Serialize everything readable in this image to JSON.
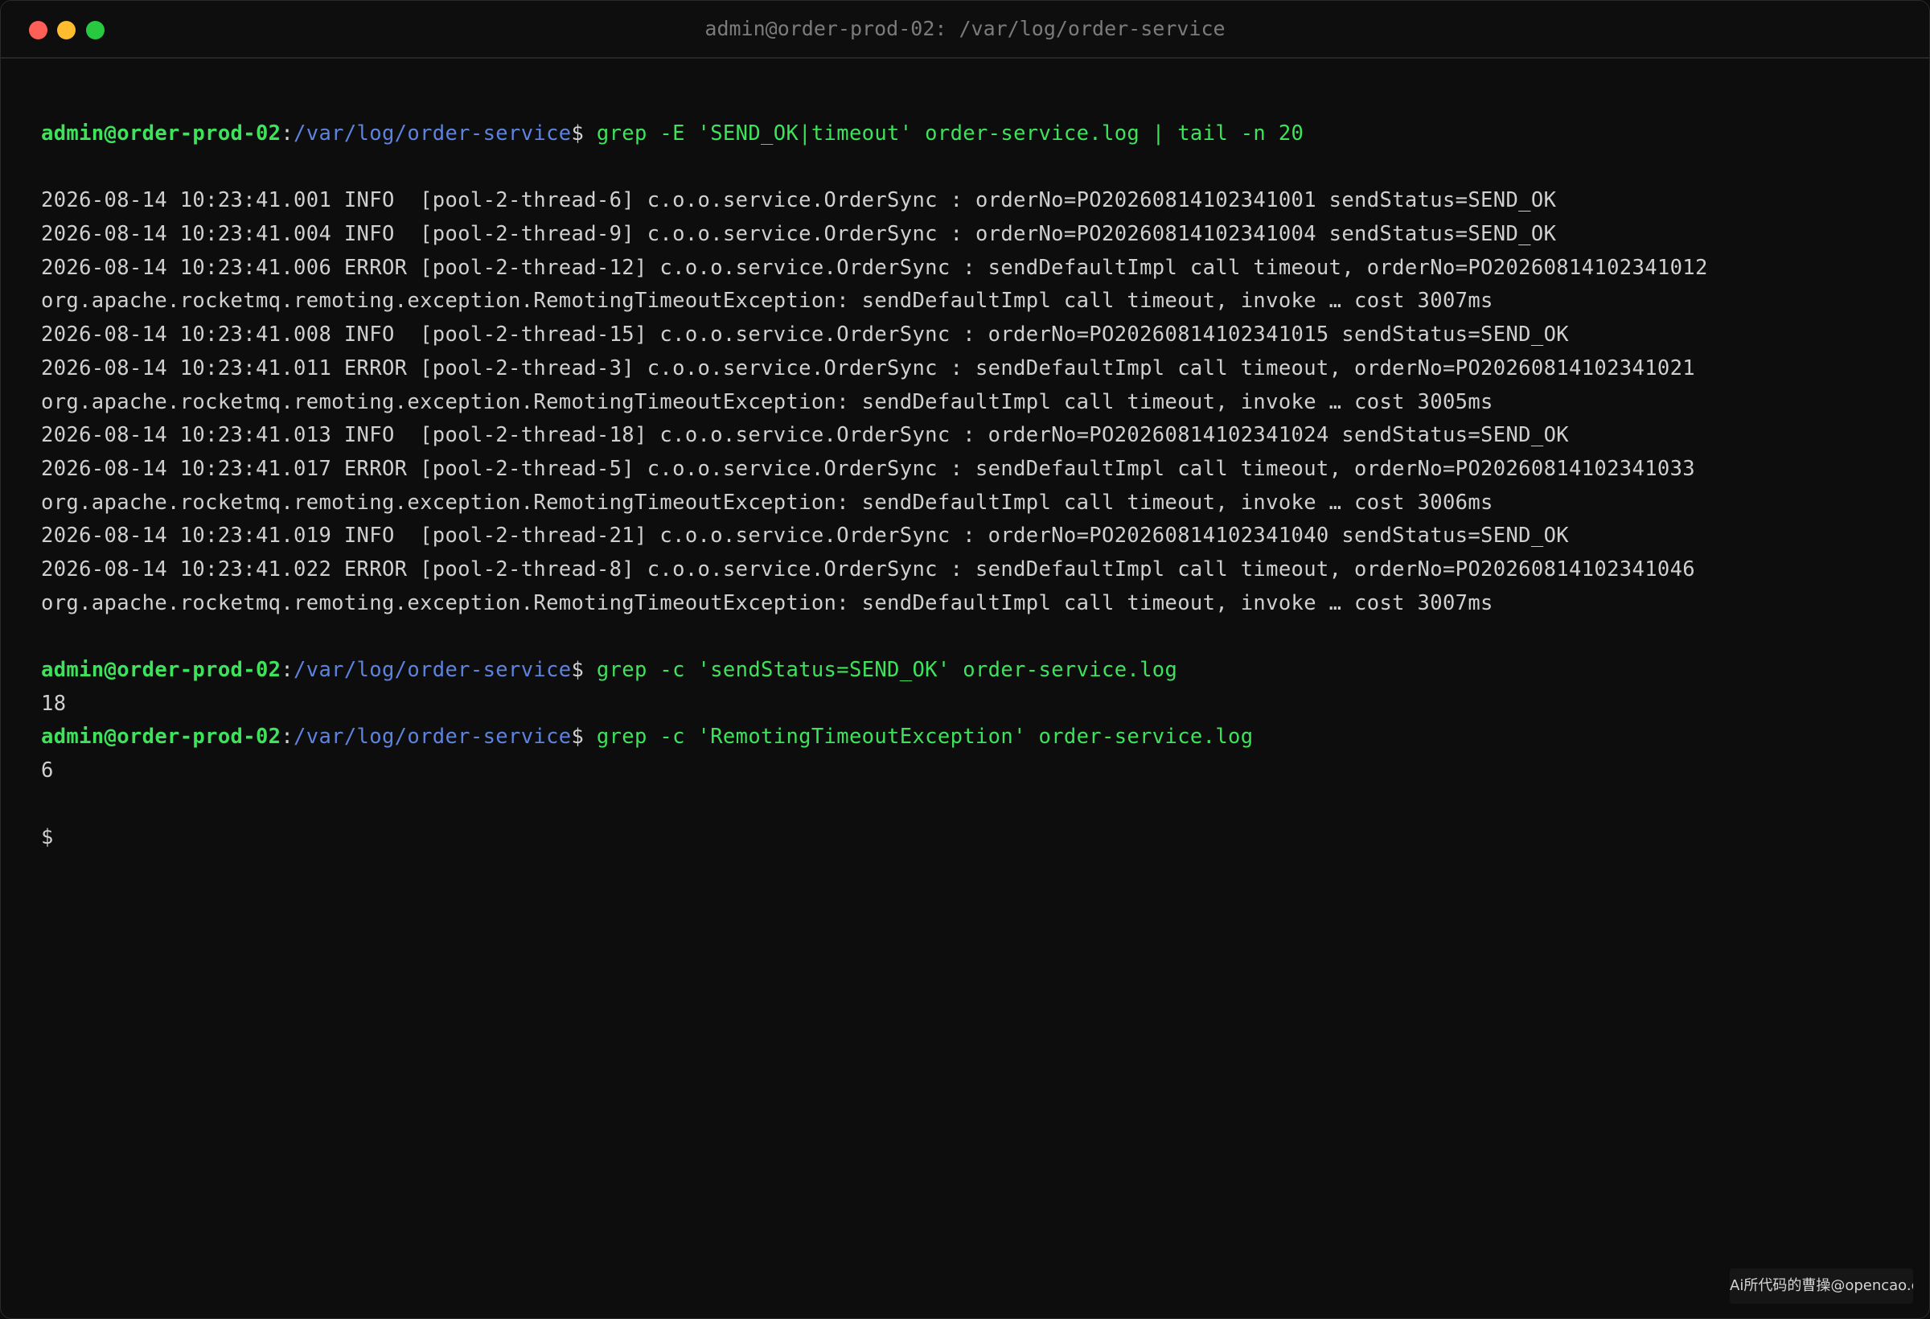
{
  "window": {
    "title": "admin@order-prod-02: /var/log/order-service",
    "controls": {
      "close_color": "#ff5f57",
      "minimize_color": "#febc2e",
      "zoom_color": "#28c840"
    }
  },
  "colors": {
    "background": "#0d0d0d",
    "prompt_user": "#3ee25b",
    "prompt_path": "#5d83df",
    "command": "#3ee25b",
    "output": "#d0d0d0"
  },
  "terminal": {
    "blocks": [
      {
        "prompt": {
          "user_host": "admin@order-prod-02",
          "separator": ":",
          "path": "/var/log/order-service",
          "symbol": "$"
        },
        "command": " grep -E 'SEND_OK|timeout' order-service.log | tail -n 20",
        "blank_before_output": true,
        "output": [
          "2026-08-14 10:23:41.001 INFO  [pool-2-thread-6] c.o.o.service.OrderSync : orderNo=PO20260814102341001 sendStatus=SEND_OK",
          "2026-08-14 10:23:41.004 INFO  [pool-2-thread-9] c.o.o.service.OrderSync : orderNo=PO20260814102341004 sendStatus=SEND_OK",
          "2026-08-14 10:23:41.006 ERROR [pool-2-thread-12] c.o.o.service.OrderSync : sendDefaultImpl call timeout, orderNo=PO20260814102341012",
          "org.apache.rocketmq.remoting.exception.RemotingTimeoutException: sendDefaultImpl call timeout, invoke … cost 3007ms",
          "2026-08-14 10:23:41.008 INFO  [pool-2-thread-15] c.o.o.service.OrderSync : orderNo=PO20260814102341015 sendStatus=SEND_OK",
          "2026-08-14 10:23:41.011 ERROR [pool-2-thread-3] c.o.o.service.OrderSync : sendDefaultImpl call timeout, orderNo=PO20260814102341021",
          "org.apache.rocketmq.remoting.exception.RemotingTimeoutException: sendDefaultImpl call timeout, invoke … cost 3005ms",
          "2026-08-14 10:23:41.013 INFO  [pool-2-thread-18] c.o.o.service.OrderSync : orderNo=PO20260814102341024 sendStatus=SEND_OK",
          "2026-08-14 10:23:41.017 ERROR [pool-2-thread-5] c.o.o.service.OrderSync : sendDefaultImpl call timeout, orderNo=PO20260814102341033",
          "org.apache.rocketmq.remoting.exception.RemotingTimeoutException: sendDefaultImpl call timeout, invoke … cost 3006ms",
          "2026-08-14 10:23:41.019 INFO  [pool-2-thread-21] c.o.o.service.OrderSync : orderNo=PO20260814102341040 sendStatus=SEND_OK",
          "2026-08-14 10:23:41.022 ERROR [pool-2-thread-8] c.o.o.service.OrderSync : sendDefaultImpl call timeout, orderNo=PO20260814102341046",
          "org.apache.rocketmq.remoting.exception.RemotingTimeoutException: sendDefaultImpl call timeout, invoke … cost 3007ms"
        ],
        "blank_after_output": true
      },
      {
        "prompt": {
          "user_host": "admin@order-prod-02",
          "separator": ":",
          "path": "/var/log/order-service",
          "symbol": "$"
        },
        "command": " grep -c 'sendStatus=SEND_OK' order-service.log",
        "blank_before_output": false,
        "output": [
          "18"
        ],
        "blank_after_output": false
      },
      {
        "prompt": {
          "user_host": "admin@order-prod-02",
          "separator": ":",
          "path": "/var/log/order-service",
          "symbol": "$"
        },
        "command": " grep -c 'RemotingTimeoutException' order-service.log",
        "blank_before_output": false,
        "output": [
          "6"
        ],
        "blank_after_output": true
      }
    ],
    "final_prompt": "$"
  },
  "watermark": {
    "text": "Ai所代码的曹操@opencao.cn"
  }
}
